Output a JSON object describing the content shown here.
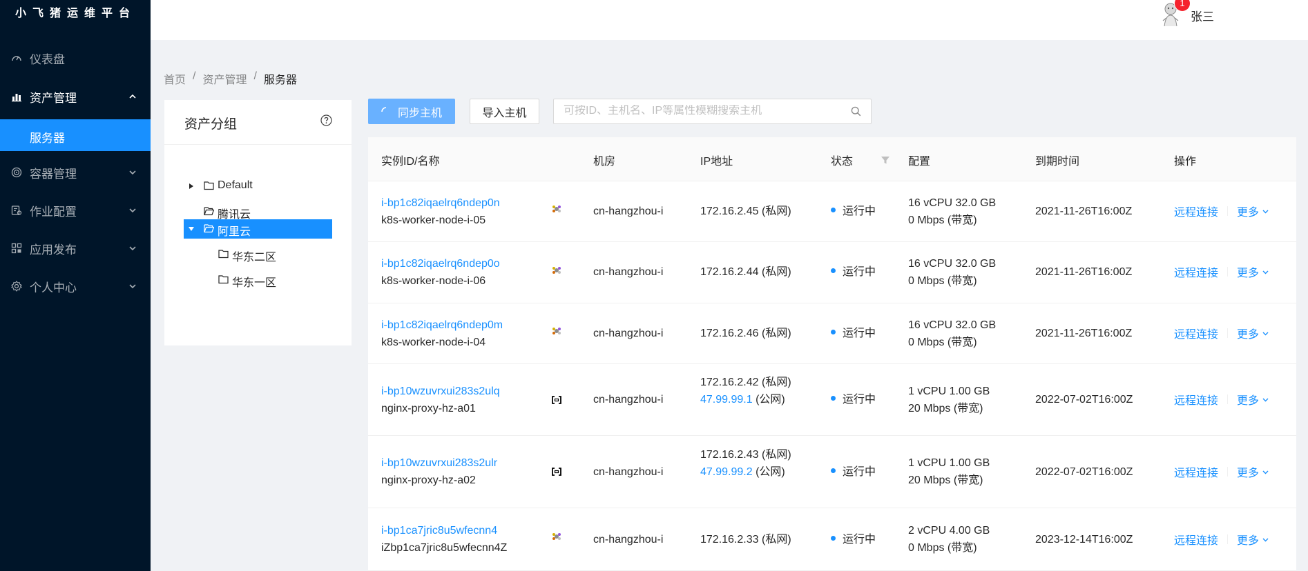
{
  "app": {
    "title": "小飞猪运维平台"
  },
  "sidebar": {
    "items": [
      {
        "label": "仪表盘",
        "icon": "dashboard-icon"
      },
      {
        "label": "资产管理",
        "icon": "bar-chart-icon",
        "open": true,
        "children": [
          {
            "label": "服务器",
            "selected": true
          }
        ]
      },
      {
        "label": "容器管理",
        "icon": "container-icon"
      },
      {
        "label": "作业配置",
        "icon": "job-config-icon"
      },
      {
        "label": "应用发布",
        "icon": "app-publish-icon"
      },
      {
        "label": "个人中心",
        "icon": "settings-icon"
      }
    ]
  },
  "header": {
    "username": "张三",
    "notification_count": "1"
  },
  "breadcrumb": {
    "items": [
      "首页",
      "资产管理",
      "服务器"
    ],
    "separator": "/"
  },
  "tree": {
    "title": "资产分组",
    "nodes": [
      {
        "label": "Default",
        "level": 0,
        "expanded": false,
        "has_children": true
      },
      {
        "label": "腾讯云",
        "level": 0
      },
      {
        "label": "阿里云",
        "level": 0,
        "expanded": true,
        "selected": true
      },
      {
        "label": "华东二区",
        "level": 1
      },
      {
        "label": "华东一区",
        "level": 1
      }
    ]
  },
  "toolbar": {
    "sync_label": "同步主机",
    "import_label": "导入主机",
    "search_placeholder": "可按ID、主机名、IP等属性模糊搜索主机"
  },
  "table": {
    "columns": [
      "实例ID/名称",
      "机房",
      "IP地址",
      "状态",
      "配置",
      "到期时间",
      "操作"
    ],
    "rows": [
      {
        "id": "i-bp1c82iqaelrq6ndep0n",
        "name": "k8s-worker-node-i-05",
        "os": "linux",
        "region": "cn-hangzhou-i",
        "ip_private": "172.16.2.45",
        "private_tag": "(私网)",
        "status": "运行中",
        "config_1": "16 vCPU 32.0 GB",
        "config_2": "0 Mbps (带宽)",
        "expire": "2021-11-26T16:00Z"
      },
      {
        "id": "i-bp1c82iqaelrq6ndep0o",
        "name": "k8s-worker-node-i-06",
        "os": "linux",
        "region": "cn-hangzhou-i",
        "ip_private": "172.16.2.44",
        "private_tag": "(私网)",
        "status": "运行中",
        "config_1": "16 vCPU 32.0 GB",
        "config_2": "0 Mbps (带宽)",
        "expire": "2021-11-26T16:00Z"
      },
      {
        "id": "i-bp1c82iqaelrq6ndep0m",
        "name": "k8s-worker-node-i-04",
        "os": "linux",
        "region": "cn-hangzhou-i",
        "ip_private": "172.16.2.46",
        "private_tag": "(私网)",
        "status": "运行中",
        "config_1": "16 vCPU 32.0 GB",
        "config_2": "0 Mbps (带宽)",
        "expire": "2021-11-26T16:00Z"
      },
      {
        "id": "i-bp10wzuvrxui283s2ulq",
        "name": "nginx-proxy-hz-a01",
        "os": "generic",
        "region": "cn-hangzhou-i",
        "ip_private": "172.16.2.42",
        "private_tag": "(私网)",
        "ip_public": "47.99.99.1",
        "public_tag": "(公网)",
        "status": "运行中",
        "config_1": "1 vCPU 1.00 GB",
        "config_2": "20 Mbps (带宽)",
        "expire": "2022-07-02T16:00Z"
      },
      {
        "id": "i-bp10wzuvrxui283s2ulr",
        "name": "nginx-proxy-hz-a02",
        "os": "generic",
        "region": "cn-hangzhou-i",
        "ip_private": "172.16.2.43",
        "private_tag": "(私网)",
        "ip_public": "47.99.99.2",
        "public_tag": "(公网)",
        "status": "运行中",
        "config_1": "1 vCPU 1.00 GB",
        "config_2": "20 Mbps (带宽)",
        "expire": "2022-07-02T16:00Z"
      },
      {
        "id": "i-bp1ca7jric8u5wfecnn4",
        "name": "iZbp1ca7jric8u5wfecnn4Z",
        "os": "linux",
        "region": "cn-hangzhou-i",
        "ip_private": "172.16.2.33",
        "private_tag": "(私网)",
        "status": "运行中",
        "config_1": "2 vCPU 4.00 GB",
        "config_2": "0 Mbps (带宽)",
        "expire": "2023-12-14T16:00Z"
      }
    ],
    "actions": {
      "connect": "远程连接",
      "more": "更多"
    }
  },
  "colors": {
    "sidebar_bg": "#001529",
    "primary": "#1890ff",
    "badge": "#f5222d"
  }
}
